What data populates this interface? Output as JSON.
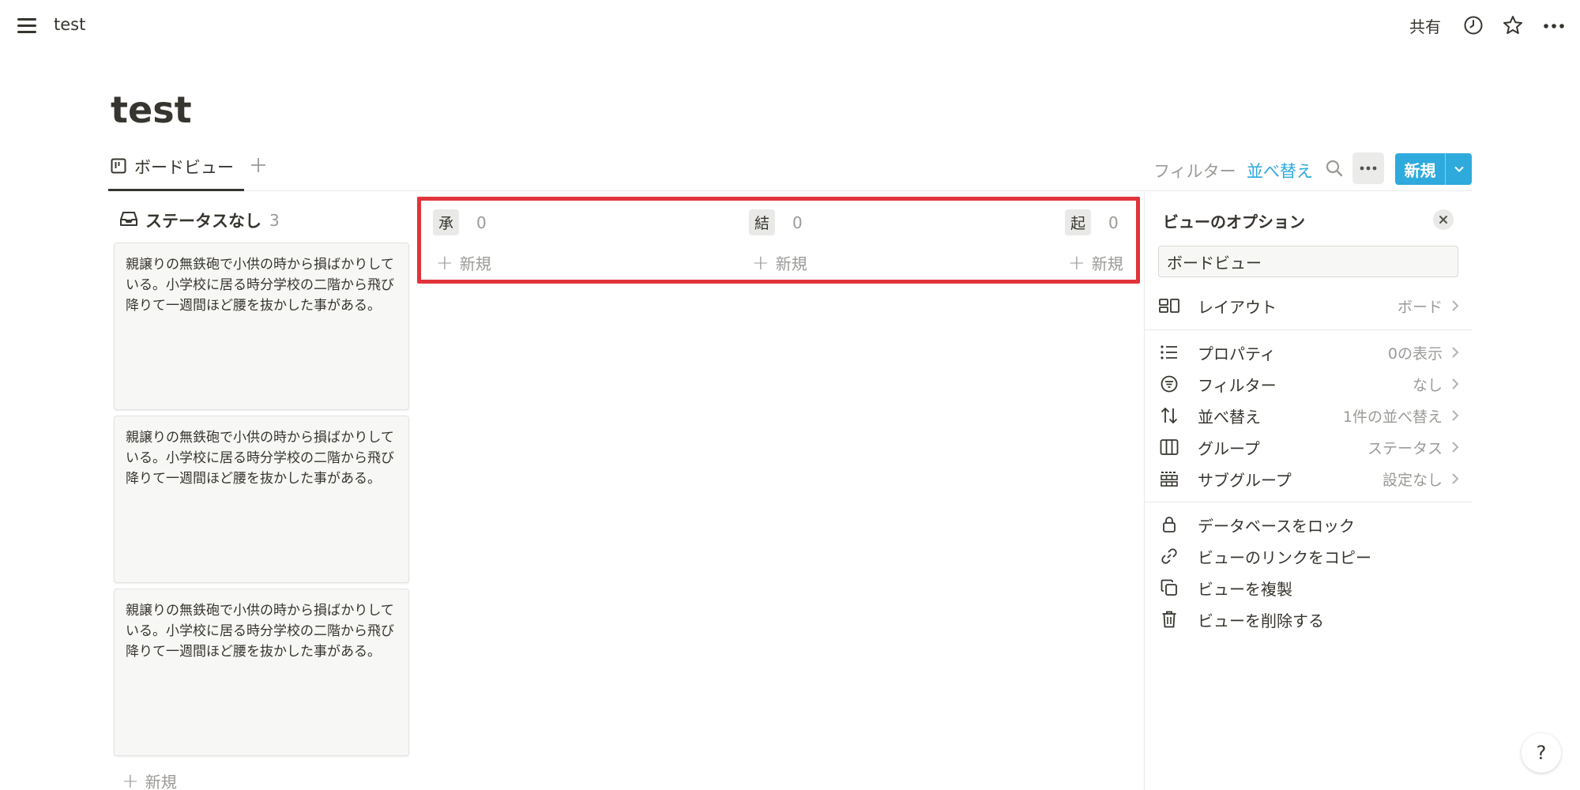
{
  "topbar": {
    "page_name": "test",
    "share_label": "共有",
    "icons": [
      "menu-icon",
      "clock-icon",
      "star-icon",
      "more-icon"
    ]
  },
  "page": {
    "title": "test"
  },
  "tabs": {
    "active_label": "ボードビュー",
    "tab_icon": "board-icon"
  },
  "toolbar": {
    "filter_label": "フィルター",
    "sort_label": "並べ替え",
    "new_label": "新規",
    "colors": {
      "accent": "#2eaadc",
      "sort_active": "#2eaadc"
    }
  },
  "board": {
    "no_status": {
      "label": "ステータスなし",
      "count": "3",
      "cards": [
        "親譲りの無鉄砲で小供の時から損ばかりしている。小学校に居る時分学校の二階から飛び降りて一週間ほど腰を抜かした事がある。",
        "親譲りの無鉄砲で小供の時から損ばかりしている。小学校に居る時分学校の二階から飛び降りて一週間ほど腰を抜かした事がある。",
        "親譲りの無鉄砲で小供の時から損ばかりしている。小学校に居る時分学校の二階から飛び降りて一週間ほど腰を抜かした事がある。"
      ],
      "new_label": "新規"
    },
    "groups": [
      {
        "label": "承",
        "count": "0",
        "new_label": "新規"
      },
      {
        "label": "結",
        "count": "0",
        "new_label": "新規"
      },
      {
        "label": "起",
        "count": "0",
        "new_label": "新規"
      }
    ],
    "highlight_color": "#e0343a"
  },
  "panel": {
    "title": "ビューのオプション",
    "view_name": "ボードビュー",
    "options": [
      {
        "label": "レイアウト",
        "value": "ボード",
        "icon": "layout-icon"
      },
      {
        "label": "プロパティ",
        "value": "0の表示",
        "icon": "list-icon"
      },
      {
        "label": "フィルター",
        "value": "なし",
        "icon": "filter-icon"
      },
      {
        "label": "並べ替え",
        "value": "1件の並べ替え",
        "icon": "sort-icon"
      },
      {
        "label": "グループ",
        "value": "ステータス",
        "icon": "columns-icon"
      },
      {
        "label": "サブグループ",
        "value": "設定なし",
        "icon": "grid-icon"
      }
    ],
    "actions": [
      {
        "label": "データベースをロック",
        "icon": "lock-icon"
      },
      {
        "label": "ビューのリンクをコピー",
        "icon": "link-icon"
      },
      {
        "label": "ビューを複製",
        "icon": "duplicate-icon"
      },
      {
        "label": "ビューを削除する",
        "icon": "trash-icon"
      }
    ]
  },
  "help": {
    "label": "?"
  }
}
